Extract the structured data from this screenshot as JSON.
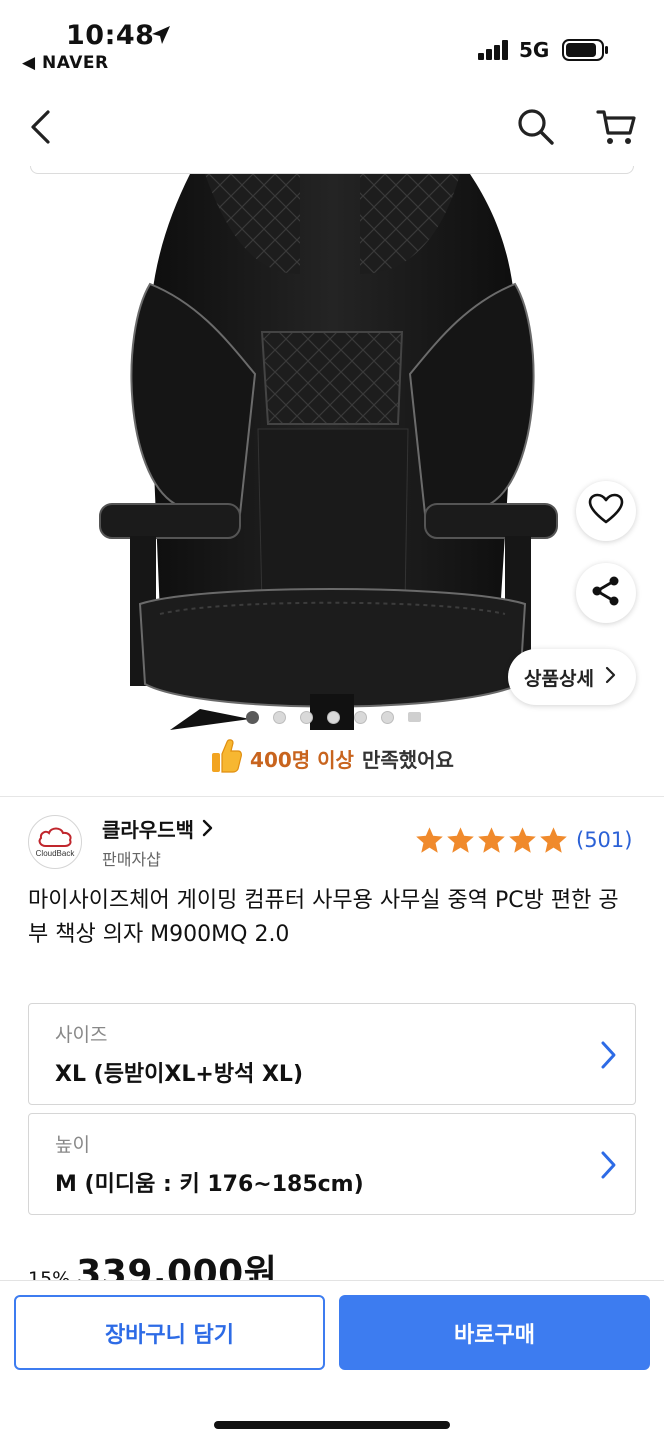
{
  "status_bar": {
    "time": "10:48",
    "back_app": "◀ NAVER",
    "network": "5G",
    "icons": [
      "location-arrow-icon",
      "signal-icon",
      "battery-icon"
    ]
  },
  "nav": {
    "icons": [
      "back-icon",
      "search-icon",
      "cart-icon"
    ]
  },
  "gallery": {
    "image": "black gaming office chair",
    "page_count": 7,
    "active_index": 0,
    "detail_button": "상품상세",
    "icons": [
      "heart-icon",
      "share-icon",
      "chevron-right-icon"
    ]
  },
  "satisfaction": {
    "highlight": "400명 이상",
    "rest": "만족했어요",
    "icon": "thumbs-up-icon"
  },
  "seller": {
    "logo_text": "CloudBack",
    "name": "클라우드백",
    "role": "판매자샵",
    "rating_stars": 5,
    "review_count": "(501)"
  },
  "product": {
    "title": "마이사이즈체어 게이밍 컴퓨터 사무용 사무실 중역 PC방 편한 공부 책상 의자 M900MQ 2.0"
  },
  "options": [
    {
      "label": "사이즈",
      "value": "XL (등받이XL+방석 XL)"
    },
    {
      "label": "높이",
      "value": "M (미디움 : 키 176~185cm)"
    }
  ],
  "price": {
    "discount": "15%",
    "amount": "339,000원"
  },
  "actions": {
    "cart_label": "장바구니 담기",
    "buy_label": "바로구매"
  },
  "colors": {
    "accent": "#3d7cf0",
    "star": "#f08a2c",
    "review_link": "#2b61d6",
    "highlight": "#c8641e"
  }
}
